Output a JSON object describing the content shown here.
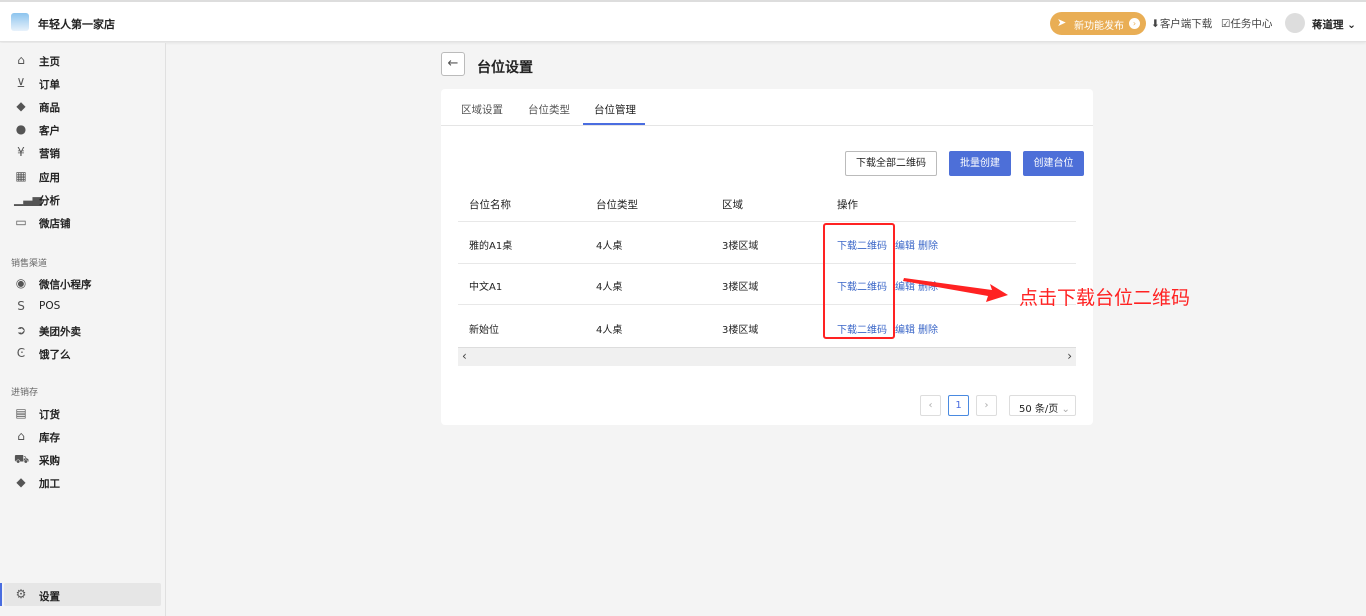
{
  "header": {
    "shop_name": "年轻人第一家店",
    "new_feature": "新功能发布",
    "client_download": "客户端下载",
    "task_center": "任务中心",
    "user_name": "蒋道理"
  },
  "sidebar": {
    "items": [
      {
        "label": "主页",
        "icon": "home-icon"
      },
      {
        "label": "订单",
        "icon": "inbox-icon"
      },
      {
        "label": "商品",
        "icon": "tag-icon"
      },
      {
        "label": "客户",
        "icon": "user-icon"
      },
      {
        "label": "营销",
        "icon": "coupon-icon"
      },
      {
        "label": "应用",
        "icon": "apps-icon"
      },
      {
        "label": "分析",
        "icon": "bar-chart-icon"
      },
      {
        "label": "微店铺",
        "icon": "store-icon"
      }
    ],
    "sales_title": "销售渠道",
    "sales": [
      {
        "label": "微信小程序",
        "icon": "miniprogram-icon"
      },
      {
        "label": "POS",
        "icon": "shopping-bag-icon"
      },
      {
        "label": "美团外卖",
        "icon": "meituan-icon"
      },
      {
        "label": "饿了么",
        "icon": "eleme-icon"
      }
    ],
    "inventory_title": "进销存",
    "inventory": [
      {
        "label": "订货",
        "icon": "document-icon"
      },
      {
        "label": "库存",
        "icon": "warehouse-icon"
      },
      {
        "label": "采购",
        "icon": "cart-icon"
      },
      {
        "label": "加工",
        "icon": "tag-plus-icon"
      }
    ],
    "settings": "设置"
  },
  "page": {
    "title": "台位设置",
    "tabs": [
      "区域设置",
      "台位类型",
      "台位管理"
    ],
    "active_tab": 2,
    "buttons": {
      "download_all": "下载全部二维码",
      "batch_create": "批量创建",
      "create": "创建台位"
    },
    "columns": [
      "台位名称",
      "台位类型",
      "区域",
      "操作"
    ],
    "rows": [
      {
        "name": "雅的A1桌",
        "type": "4人桌",
        "area": "3楼区域"
      },
      {
        "name": "中文A1",
        "type": "4人桌",
        "area": "3楼区域"
      },
      {
        "name": "新始位",
        "type": "4人桌",
        "area": "3楼区域"
      }
    ],
    "actions": {
      "download": "下载二维码",
      "edit": "编辑",
      "delete": "删除"
    },
    "pagination": {
      "current": "1",
      "page_size": "50 条/页"
    }
  },
  "annotation": {
    "text": "点击下载台位二维码",
    "color": "#ff2222"
  }
}
